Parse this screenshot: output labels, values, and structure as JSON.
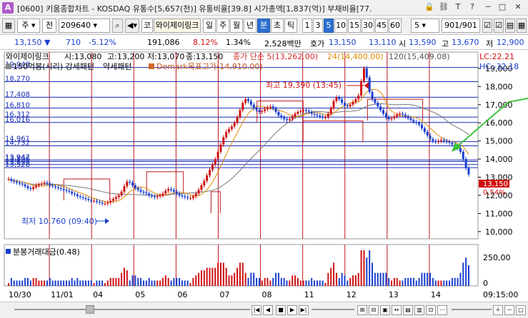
{
  "window": {
    "title": "[0600] 키움종합차트 - KOSDAQ 유통수[5,657(천)] 유통비율[39.8] 시가총액[1,837(억)] 부채비율[77.",
    "icon_letter": "A"
  },
  "toolbar": {
    "market_mode": "주",
    "prev_label": "전",
    "stock_code": "209640",
    "search_code_label": "코",
    "stock_name": "와이제이링크",
    "periods": [
      "일",
      "주",
      "월",
      "년",
      "분",
      "초",
      "틱"
    ],
    "selected_period": "분",
    "intervals": [
      "1",
      "3",
      "5",
      "10",
      "15",
      "30",
      "45",
      "60"
    ],
    "selected_interval": "5",
    "interval_input": "5",
    "page_counter": "901",
    "page_total": "/901"
  },
  "quote": {
    "price": "13,150",
    "change": "710",
    "change_rate": "-5.12%",
    "volume": "191,086",
    "turnover_rate": "8.12%",
    "ratio": "1.34%",
    "amount": "2,528백만",
    "bid_label": "호가",
    "bid": "13,150",
    "ask": "13,110",
    "open_label": "시",
    "open": "13,590",
    "high_label": "고",
    "high": "13,670",
    "low_label": "저",
    "low": "12,900"
  },
  "chart_data": {
    "type": "candlestick",
    "legend_line1": {
      "name": "와이제이링크",
      "open": "시:13,080",
      "high": "고:13,200",
      "low": "저:13,070",
      "close": "종:13,150",
      "ma_label": "종가 단순 5(13,262.00)",
      "ma24": "24(14,400.00)",
      "ma120": "120(15,409.08)"
    },
    "legend_line2": {
      "pattern1": "150억봉(시리) 강세패턴",
      "pattern2": "약세패턴",
      "demark": "Demark목표고가(14,910.00)"
    },
    "corner_lc": "LC:22.21",
    "corner_hc": "HC:-32.18",
    "annotations": {
      "high_note": "최고 19,390 (13:45)",
      "low_note": "최저 10,760 (09:40)"
    },
    "price_lines": [
      "19,048",
      "18,270",
      "17,408",
      "16,810",
      "16,312",
      "16,016",
      "14,961",
      "14,732",
      "13,947",
      "13,866",
      "13,698",
      "13,528"
    ],
    "y_axis_ticks": [
      "19,000",
      "18,000",
      "17,000",
      "16,000",
      "15,000",
      "14,000",
      "13,000",
      "12,000",
      "11,000",
      "10,000"
    ],
    "y_range": [
      9600,
      19900
    ],
    "current_price_tag": "13,150",
    "current_change_tag": "0.54%",
    "volume_pane": {
      "title": "분봉거래대금(0.48)",
      "y_ticks": [
        "250,00",
        "0"
      ]
    },
    "x_tick_labels": [
      "10/30",
      "11/01",
      "04",
      "05",
      "06",
      "07",
      "08",
      "11",
      "12",
      "13",
      "14"
    ],
    "x_end_label": "09:15:00",
    "close_series": [
      12900,
      12800,
      12750,
      12700,
      12650,
      12600,
      12500,
      12400,
      12350,
      12450,
      12550,
      12600,
      12650,
      12700,
      12650,
      12550,
      12500,
      12450,
      12400,
      12350,
      12300,
      12250,
      12200,
      12100,
      12050,
      11950,
      11900,
      11850,
      11800,
      11750,
      11700,
      11700,
      11650,
      11600,
      11550,
      11550,
      11600,
      11700,
      11800,
      11900,
      12000,
      12200,
      12500,
      12750,
      12700,
      12550,
      12400,
      12300,
      12200,
      12150,
      12100,
      12000,
      11950,
      11900,
      11950,
      12000,
      12100,
      12250,
      12350,
      12300,
      12200,
      12100,
      12000,
      11950,
      11900,
      11850,
      11850,
      11950,
      12100,
      12300,
      12550,
      12800,
      13100,
      13400,
      13700,
      14000,
      14400,
      14800,
      15200,
      15500,
      15650,
      15800,
      16000,
      16300,
      16700,
      17100,
      17300,
      17200,
      17000,
      16800,
      16700,
      16600,
      16650,
      16750,
      16850,
      16900,
      16800,
      16600,
      16400,
      16300,
      16200,
      16150,
      16200,
      16350,
      16500,
      16600,
      16650,
      16700,
      16650,
      16600,
      16500,
      16450,
      16400,
      16350,
      16300,
      16300,
      16500,
      16800,
      17200,
      17400,
      17300,
      17100,
      16950,
      16900,
      17000,
      17150,
      17300,
      17500,
      18300,
      19000,
      18500,
      17700,
      17300,
      17100,
      16900,
      16700,
      16500,
      16300,
      16200,
      16250,
      16350,
      16450,
      16500,
      16450,
      16350,
      16250,
      16150,
      16050,
      16000,
      15900,
      15700,
      15500,
      15300,
      15100,
      15000,
      14950,
      15000,
      15050,
      15000,
      14950,
      14900,
      14800,
      14700,
      14600,
      14400,
      14000,
      13500,
      13150
    ]
  }
}
